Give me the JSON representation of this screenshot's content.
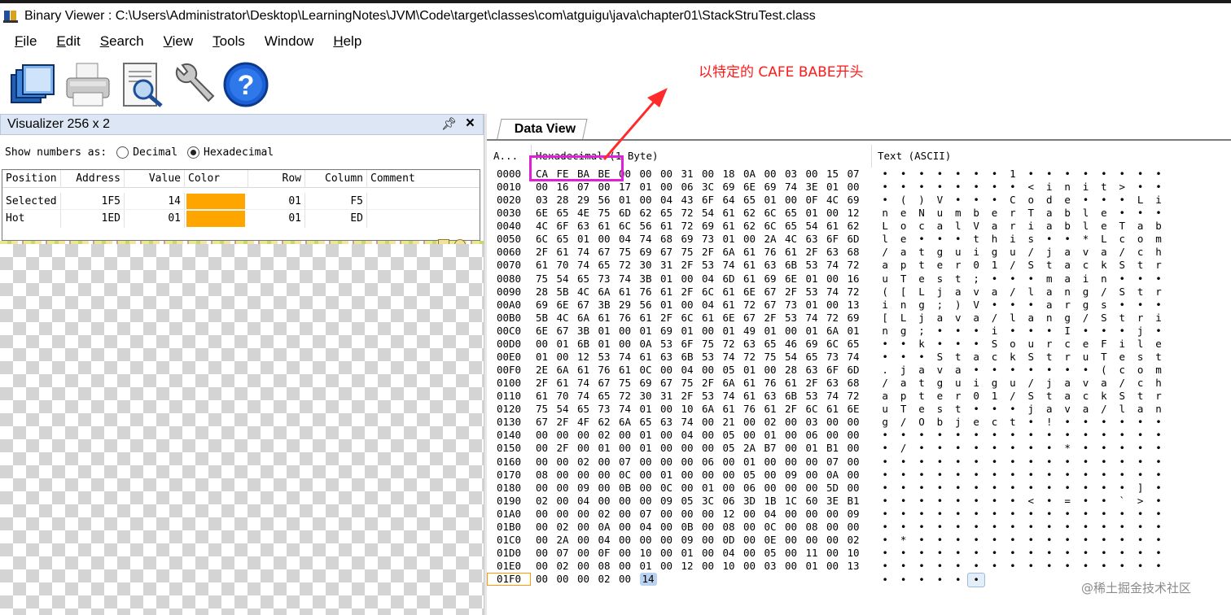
{
  "window": {
    "title": "Binary Viewer : C:\\Users\\Administrator\\Desktop\\LearningNotes\\JVM\\Code\\target\\classes\\com\\atguigu\\java\\chapter01\\StackStruTest.class"
  },
  "menu": [
    {
      "label": "File",
      "hot": "F",
      "rest": "ile"
    },
    {
      "label": "Edit",
      "hot": "E",
      "rest": "dit"
    },
    {
      "label": "Search",
      "hot": "S",
      "rest": "earch"
    },
    {
      "label": "View",
      "hot": "V",
      "rest": "iew"
    },
    {
      "label": "Tools",
      "hot": "T",
      "rest": "ools"
    },
    {
      "label": "Window",
      "hot": "",
      "rest": "Window"
    },
    {
      "label": "Help",
      "hot": "H",
      "rest": "elp"
    }
  ],
  "toolbar": {
    "icons": [
      "open-file-icon",
      "print-icon",
      "print-preview-icon",
      "wrench-icon",
      "help-icon"
    ]
  },
  "annotation": "以特定的 CAFE BABE开头",
  "visualizer": {
    "title": "Visualizer 256 x 2",
    "show_numbers_label": "Show numbers as:",
    "options": [
      "Decimal",
      "Hexadecimal"
    ],
    "selected_option": "Hexadecimal",
    "columns": [
      "Position",
      "Address",
      "Value",
      "Color",
      "Row",
      "Column",
      "Comment"
    ],
    "rows": [
      {
        "position": "Selected",
        "address": "1F5",
        "value": "14",
        "color": "#ffa500",
        "row": "01",
        "column": "F5",
        "comment": ""
      },
      {
        "position": "Hot",
        "address": "1ED",
        "value": "01",
        "color": "#ffa500",
        "row": "01",
        "column": "ED",
        "comment": ""
      }
    ]
  },
  "data_view": {
    "tab": "Data View",
    "headers": {
      "address": "A...",
      "hex": "Hexadecimal (1 Byte)",
      "text": "Text (ASCII)"
    },
    "current_address": "01F0",
    "selected_byte": "14",
    "rows": [
      {
        "addr": "0000",
        "hex": "CA FE BA BE 00 00 00 31 00 18 0A 00 03 00 15 07",
        "text": "• • • • • • • 1 • • • • • • • •"
      },
      {
        "addr": "0010",
        "hex": "00 16 07 00 17 01 00 06 3C 69 6E 69 74 3E 01 00",
        "text": "• • • • • • • • < i n i t > • •"
      },
      {
        "addr": "0020",
        "hex": "03 28 29 56 01 00 04 43 6F 64 65 01 00 0F 4C 69",
        "text": "• ( ) V • • • C o d e • • • L i"
      },
      {
        "addr": "0030",
        "hex": "6E 65 4E 75 6D 62 65 72 54 61 62 6C 65 01 00 12",
        "text": "n e N u m b e r T a b l e • • •"
      },
      {
        "addr": "0040",
        "hex": "4C 6F 63 61 6C 56 61 72 69 61 62 6C 65 54 61 62",
        "text": "L o c a l V a r i a b l e T a b"
      },
      {
        "addr": "0050",
        "hex": "6C 65 01 00 04 74 68 69 73 01 00 2A 4C 63 6F 6D",
        "text": "l e • • • t h i s • • * L c o m"
      },
      {
        "addr": "0060",
        "hex": "2F 61 74 67 75 69 67 75 2F 6A 61 76 61 2F 63 68",
        "text": "/ a t g u i g u / j a v a / c h"
      },
      {
        "addr": "0070",
        "hex": "61 70 74 65 72 30 31 2F 53 74 61 63 6B 53 74 72",
        "text": "a p t e r 0 1 / S t a c k S t r"
      },
      {
        "addr": "0080",
        "hex": "75 54 65 73 74 3B 01 00 04 6D 61 69 6E 01 00 16",
        "text": "u T e s t ; • • • m a i n • • •"
      },
      {
        "addr": "0090",
        "hex": "28 5B 4C 6A 61 76 61 2F 6C 61 6E 67 2F 53 74 72",
        "text": "( [ L j a v a / l a n g / S t r"
      },
      {
        "addr": "00A0",
        "hex": "69 6E 67 3B 29 56 01 00 04 61 72 67 73 01 00 13",
        "text": "i n g ; ) V • • • a r g s • • •"
      },
      {
        "addr": "00B0",
        "hex": "5B 4C 6A 61 76 61 2F 6C 61 6E 67 2F 53 74 72 69",
        "text": "[ L j a v a / l a n g / S t r i"
      },
      {
        "addr": "00C0",
        "hex": "6E 67 3B 01 00 01 69 01 00 01 49 01 00 01 6A 01",
        "text": "n g ; • • • i • • • I • • • j •"
      },
      {
        "addr": "00D0",
        "hex": "00 01 6B 01 00 0A 53 6F 75 72 63 65 46 69 6C 65",
        "text": "• • k • • • S o u r c e F i l e"
      },
      {
        "addr": "00E0",
        "hex": "01 00 12 53 74 61 63 6B 53 74 72 75 54 65 73 74",
        "text": "• • • S t a c k S t r u T e s t"
      },
      {
        "addr": "00F0",
        "hex": "2E 6A 61 76 61 0C 00 04 00 05 01 00 28 63 6F 6D",
        "text": ". j a v a • • • • • • • ( c o m"
      },
      {
        "addr": "0100",
        "hex": "2F 61 74 67 75 69 67 75 2F 6A 61 76 61 2F 63 68",
        "text": "/ a t g u i g u / j a v a / c h"
      },
      {
        "addr": "0110",
        "hex": "61 70 74 65 72 30 31 2F 53 74 61 63 6B 53 74 72",
        "text": "a p t e r 0 1 / S t a c k S t r"
      },
      {
        "addr": "0120",
        "hex": "75 54 65 73 74 01 00 10 6A 61 76 61 2F 6C 61 6E",
        "text": "u T e s t • • • j a v a / l a n"
      },
      {
        "addr": "0130",
        "hex": "67 2F 4F 62 6A 65 63 74 00 21 00 02 00 03 00 00",
        "text": "g / O b j e c t • ! • • • • • •"
      },
      {
        "addr": "0140",
        "hex": "00 00 00 02 00 01 00 04 00 05 00 01 00 06 00 00",
        "text": "• • • • • • • • • • • • • • • •"
      },
      {
        "addr": "0150",
        "hex": "00 2F 00 01 00 01 00 00 00 05 2A B7 00 01 B1 00",
        "text": "• / • • • • • • • • * • • • • •"
      },
      {
        "addr": "0160",
        "hex": "00 00 02 00 07 00 00 00 06 00 01 00 00 00 07 00",
        "text": "• • • • • • • • • • • • • • • •"
      },
      {
        "addr": "0170",
        "hex": "08 00 00 00 0C 00 01 00 00 00 05 00 09 00 0A 00",
        "text": "• • • • • • • • • • • • • • • •"
      },
      {
        "addr": "0180",
        "hex": "00 00 09 00 0B 00 0C 00 01 00 06 00 00 00 5D 00",
        "text": "• • • • • • • • • • • • • • ] •"
      },
      {
        "addr": "0190",
        "hex": "02 00 04 00 00 00 09 05 3C 06 3D 1B 1C 60 3E B1",
        "text": "• • • • • • • • < • = • • ` > •"
      },
      {
        "addr": "01A0",
        "hex": "00 00 00 02 00 07 00 00 00 12 00 04 00 00 00 09",
        "text": "• • • • • • • • • • • • • • • •"
      },
      {
        "addr": "01B0",
        "hex": "00 02 00 0A 00 04 00 0B 00 08 00 0C 00 08 00 00",
        "text": "• • • • • • • • • • • • • • • •"
      },
      {
        "addr": "01C0",
        "hex": "00 2A 00 04 00 00 00 09 00 0D 00 0E 00 00 00 02",
        "text": "• * • • • • • • • • • • • • • •"
      },
      {
        "addr": "01D0",
        "hex": "00 07 00 0F 00 10 00 01 00 04 00 05 00 11 00 10",
        "text": "• • • • • • • • • • • • • • • •"
      },
      {
        "addr": "01E0",
        "hex": "00 02 00 08 00 01 00 12 00 10 00 03 00 01 00 13",
        "text": "• • • • • • • • • • • • • • • •"
      },
      {
        "addr": "01F0",
        "hex": "00 00 00 02 00 14",
        "text": "• • • • • •"
      }
    ]
  },
  "watermark": "@稀土掘金技术社区"
}
